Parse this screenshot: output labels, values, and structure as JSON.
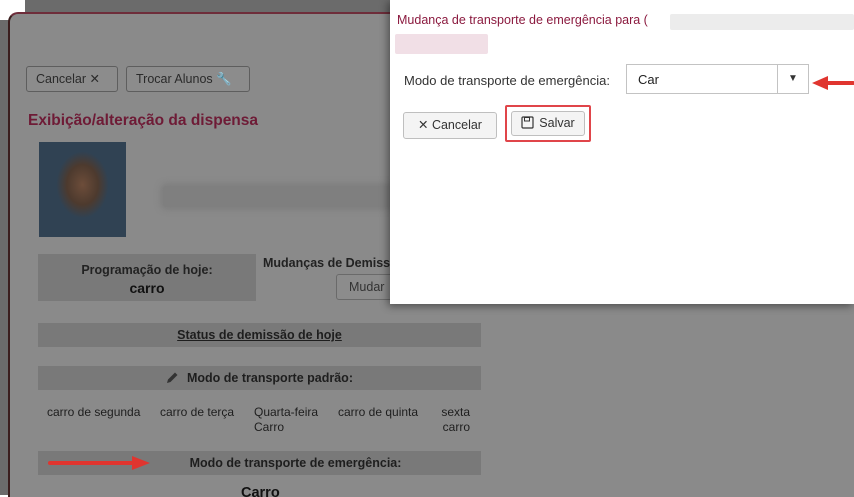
{
  "background_page": {
    "toolbar": {
      "cancel_label": "Cancelar ✕",
      "switch_students_label": "Trocar Alunos 🔧"
    },
    "section_title": "Exibição/alteração da dispensa",
    "today_schedule": {
      "label": "Programação de hoje:",
      "value": "carro"
    },
    "dismissal_changes": {
      "label": "Mudanças de Demissã",
      "change_button": "Mudar"
    },
    "status_header": "Status de demissão de hoje",
    "default_mode_header": "Modo de transporte padrão:",
    "days": [
      {
        "name": "carro de segunda",
        "value": ""
      },
      {
        "name": "carro de terça",
        "value": ""
      },
      {
        "name": "Quarta-feira",
        "value": "Carro"
      },
      {
        "name": "carro de quinta",
        "value": ""
      },
      {
        "name": "sexta",
        "value": "carro"
      }
    ],
    "emergency_mode_header": "Modo de transporte de emergência:",
    "emergency_mode_value": "Carro"
  },
  "modal": {
    "title": "Mudança de transporte de emergência para (",
    "field_label": "Modo de transporte de emergência:",
    "select_value": "Car",
    "cancel_label": "✕ Cancelar",
    "save_label": "Salvar"
  },
  "colors": {
    "accent_maroon": "#8b1a3f",
    "annotation_red": "#e0352f",
    "overlay_gray": "#8a8a8a"
  },
  "icons": [
    "close-icon",
    "wrench-icon",
    "pencil-icon",
    "chevron-down-icon",
    "floppy-disk-icon",
    "arrow-annotation"
  ]
}
